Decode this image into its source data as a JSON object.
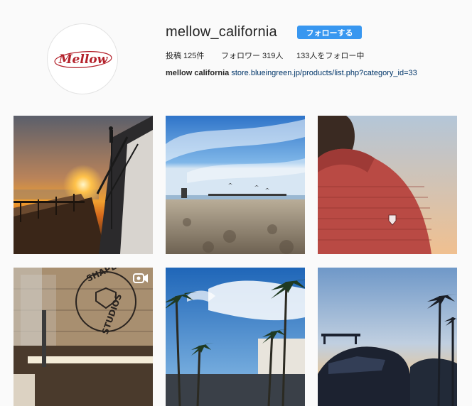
{
  "profile": {
    "username": "mellow_california",
    "follow_label": "フォローする",
    "avatar_text": "Mellow",
    "stats": {
      "posts": "投稿 125件",
      "followers": "フォロワー 319人",
      "following": "133人をフォロー中"
    },
    "bio": {
      "name": "mellow california",
      "link": "store.blueingreen.jp/products/list.php?category_id=33"
    }
  },
  "posts": [
    {
      "kind": "image"
    },
    {
      "kind": "image"
    },
    {
      "kind": "image"
    },
    {
      "kind": "video",
      "sign_text": [
        "SHAPER",
        "STUDIOS"
      ]
    },
    {
      "kind": "image"
    },
    {
      "kind": "image"
    }
  ],
  "colors": {
    "accent": "#3897f0",
    "link": "#003569",
    "background": "#fafafa"
  }
}
